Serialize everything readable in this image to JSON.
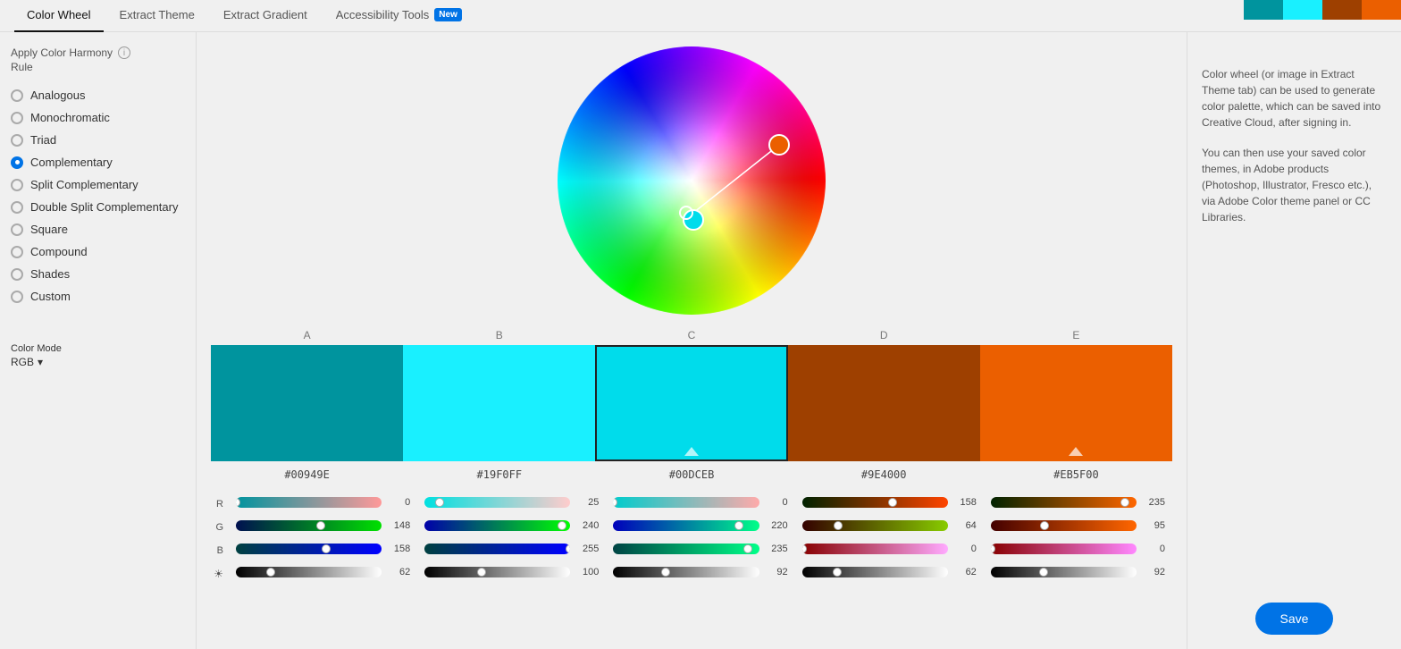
{
  "nav": {
    "tabs": [
      {
        "id": "color-wheel",
        "label": "Color Wheel",
        "active": true
      },
      {
        "id": "extract-theme",
        "label": "Extract Theme",
        "active": false
      },
      {
        "id": "extract-gradient",
        "label": "Extract Gradient",
        "active": false
      },
      {
        "id": "accessibility-tools",
        "label": "Accessibility Tools",
        "active": false
      }
    ],
    "new_badge": "New"
  },
  "top_preview_colors": [
    "#00949E",
    "#19F0FF",
    "#9E4000",
    "#EB5F00"
  ],
  "left_panel": {
    "harmony_label": "Apply Color Harmony",
    "rule_label": "Rule",
    "info_icon": "i",
    "radio_items": [
      {
        "id": "analogous",
        "label": "Analogous",
        "selected": false
      },
      {
        "id": "monochromatic",
        "label": "Monochromatic",
        "selected": false
      },
      {
        "id": "triad",
        "label": "Triad",
        "selected": false
      },
      {
        "id": "complementary",
        "label": "Complementary",
        "selected": true
      },
      {
        "id": "split-complementary",
        "label": "Split Complementary",
        "selected": false
      },
      {
        "id": "double-split-complementary",
        "label": "Double Split Complementary",
        "selected": false
      },
      {
        "id": "square",
        "label": "Square",
        "selected": false
      },
      {
        "id": "compound",
        "label": "Compound",
        "selected": false
      },
      {
        "id": "shades",
        "label": "Shades",
        "selected": false
      },
      {
        "id": "custom",
        "label": "Custom",
        "selected": false
      }
    ]
  },
  "color_mode": {
    "label": "Color Mode",
    "value": "RGB"
  },
  "swatches": [
    {
      "id": "A",
      "label": "A",
      "color": "#00949E",
      "hex": "#00949E",
      "selected": false
    },
    {
      "id": "B",
      "label": "B",
      "color": "#19F0FF",
      "hex": "#19F0FF",
      "selected": false
    },
    {
      "id": "C",
      "label": "C",
      "color": "#00DCEB",
      "hex": "#00DCEB",
      "selected": true
    },
    {
      "id": "D",
      "label": "D",
      "color": "#9E4000",
      "hex": "#9E4000",
      "selected": false
    },
    {
      "id": "E",
      "label": "E",
      "color": "#EB5F00",
      "hex": "#EB5F00",
      "selected": false
    }
  ],
  "slider_groups": [
    {
      "swatch_id": "A",
      "R": {
        "value": 0,
        "pct": 0
      },
      "G": {
        "value": 148,
        "pct": 58
      },
      "B": {
        "value": 158,
        "pct": 62
      },
      "H": {
        "value": 62,
        "pct": 24
      }
    },
    {
      "swatch_id": "B",
      "R": {
        "value": 25,
        "pct": 10
      },
      "G": {
        "value": 240,
        "pct": 94
      },
      "B": {
        "value": 255,
        "pct": 100
      },
      "H": {
        "value": 100,
        "pct": 39
      }
    },
    {
      "swatch_id": "C",
      "R": {
        "value": 0,
        "pct": 0
      },
      "G": {
        "value": 220,
        "pct": 86
      },
      "B": {
        "value": 235,
        "pct": 92
      },
      "H": {
        "value": 92,
        "pct": 36
      }
    },
    {
      "swatch_id": "D",
      "R": {
        "value": 158,
        "pct": 62
      },
      "G": {
        "value": 64,
        "pct": 25
      },
      "B": {
        "value": 0,
        "pct": 0
      },
      "H": {
        "value": 62,
        "pct": 24
      }
    },
    {
      "swatch_id": "E",
      "R": {
        "value": 235,
        "pct": 92
      },
      "G": {
        "value": 95,
        "pct": 37
      },
      "B": {
        "value": 0,
        "pct": 0
      },
      "H": {
        "value": 92,
        "pct": 36
      }
    }
  ],
  "right_panel": {
    "description1": "Color wheel (or image in Extract Theme tab) can be used to generate color palette, which can be saved into Creative Cloud, after signing in.",
    "description2": "You can then use your saved color themes, in Adobe products (Photoshop, Illustrator, Fresco etc.), via Adobe Color theme panel or CC Libraries.",
    "save_label": "Save"
  }
}
